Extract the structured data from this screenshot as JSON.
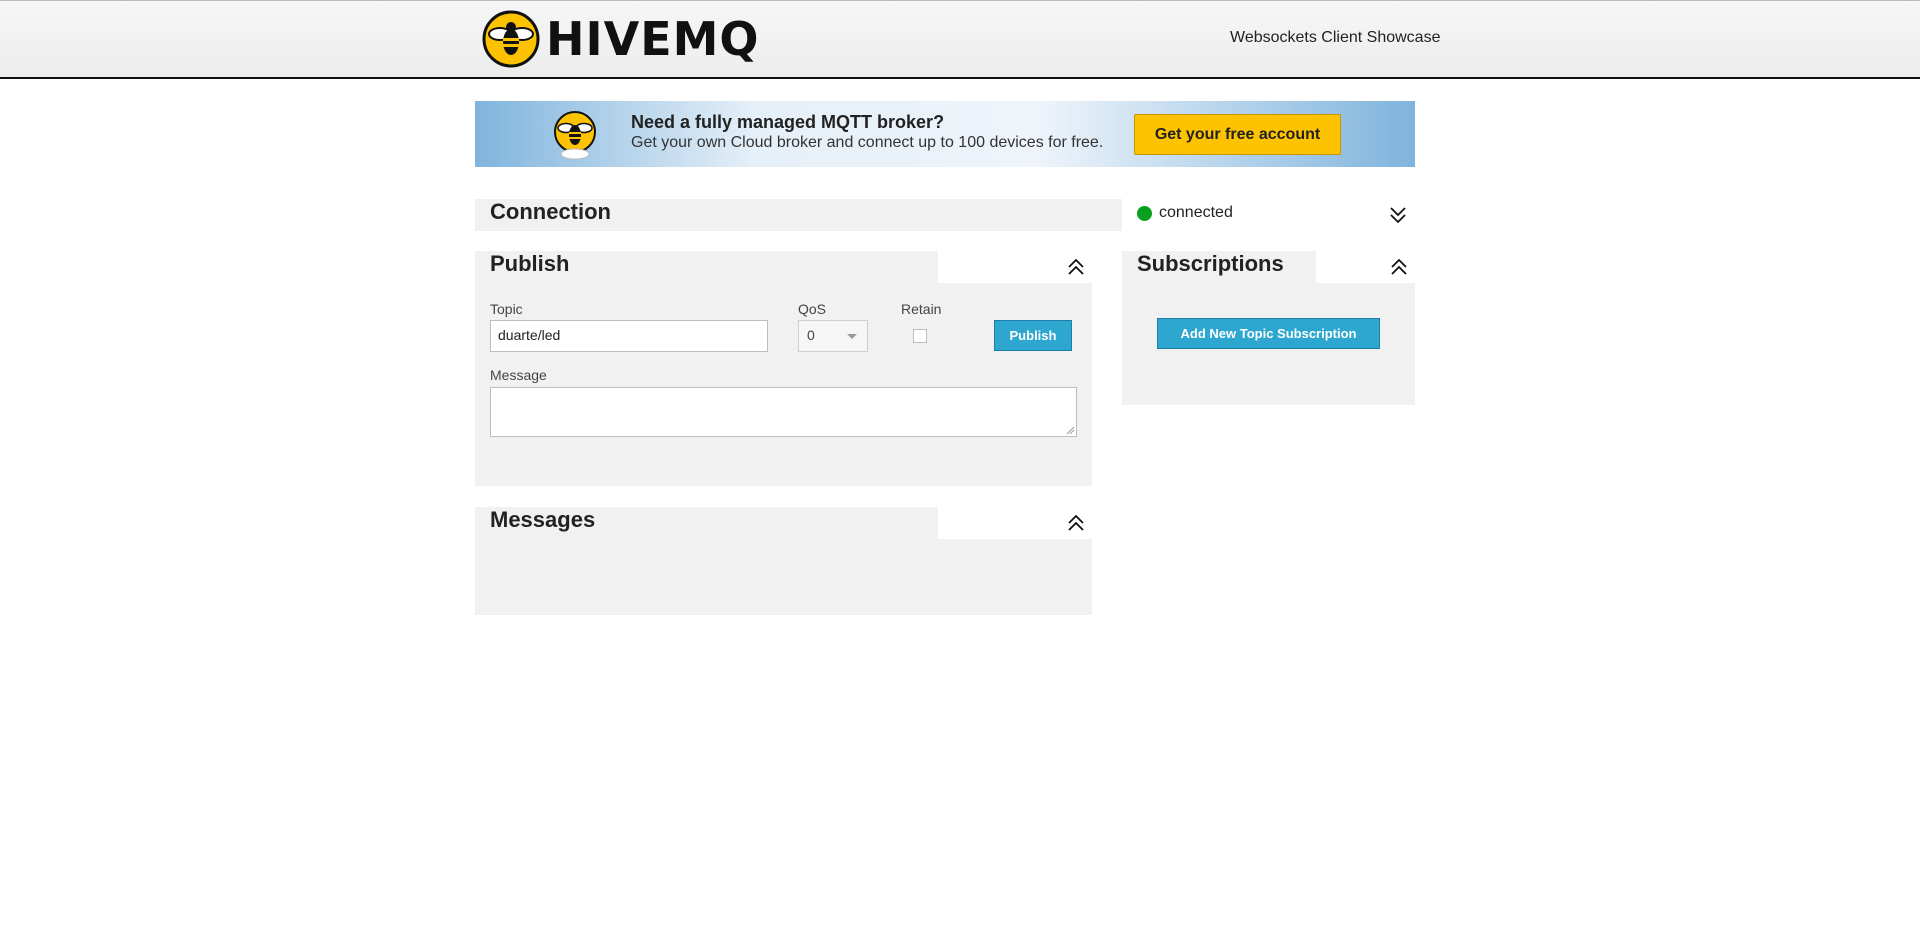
{
  "header": {
    "logo_text": "HIVEMQ",
    "tagline": "Websockets Client Showcase"
  },
  "banner": {
    "title": "Need a fully managed MQTT broker?",
    "subtitle": "Get your own Cloud broker and connect up to 100 devices for free.",
    "cta_label": "Get your free account"
  },
  "connection": {
    "title": "Connection",
    "status": "connected",
    "status_color": "#0a9f1f"
  },
  "publish": {
    "title": "Publish",
    "topic_label": "Topic",
    "topic_value": "duarte/led",
    "qos_label": "QoS",
    "qos_value": "0",
    "retain_label": "Retain",
    "retain_checked": false,
    "publish_label": "Publish",
    "message_label": "Message",
    "message_value": ""
  },
  "messages": {
    "title": "Messages"
  },
  "subscriptions": {
    "title": "Subscriptions",
    "add_label": "Add New Topic Subscription"
  },
  "colors": {
    "accent_blue": "#2ea7d0",
    "brand_yellow": "#fdc300",
    "panel_bg": "#f1f1f1"
  },
  "icons": {
    "collapse": "chevron-double-up-icon",
    "expand": "chevron-double-down-icon",
    "logo": "bee-logo-icon"
  }
}
